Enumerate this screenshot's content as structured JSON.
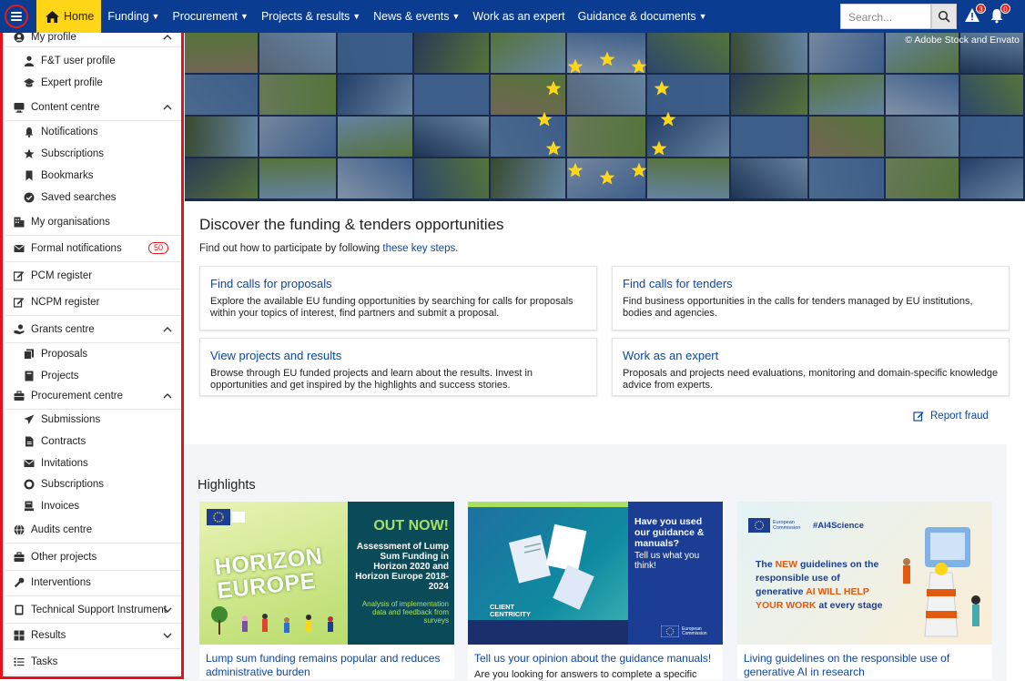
{
  "topbar": {
    "home": "Home",
    "nav": [
      {
        "label": "Funding",
        "dropdown": true
      },
      {
        "label": "Procurement",
        "dropdown": true
      },
      {
        "label": "Projects & results",
        "dropdown": true
      },
      {
        "label": "News & events",
        "dropdown": true
      },
      {
        "label": "Work as an expert",
        "dropdown": false
      },
      {
        "label": "Guidance & documents",
        "dropdown": true
      }
    ],
    "search_placeholder": "Search...",
    "alerts_count": "3",
    "notifications_count": "0"
  },
  "sidebar": {
    "items": [
      {
        "label": "My profile",
        "icon": "user-circle-icon",
        "level": 0,
        "chevron": "up"
      },
      {
        "label": "F&T user profile",
        "icon": "person-icon",
        "level": 1
      },
      {
        "label": "Expert profile",
        "icon": "graduation-cap-icon",
        "level": 1
      },
      {
        "label": "Content centre",
        "icon": "monitor-icon",
        "level": 0,
        "chevron": "up"
      },
      {
        "label": "Notifications",
        "icon": "bell-icon",
        "level": 1
      },
      {
        "label": "Subscriptions",
        "icon": "star-icon",
        "level": 1
      },
      {
        "label": "Bookmarks",
        "icon": "bookmark-icon",
        "level": 1
      },
      {
        "label": "Saved searches",
        "icon": "check-circle-icon",
        "level": 1
      },
      {
        "label": "My organisations",
        "icon": "building-icon",
        "level": 0
      },
      {
        "label": "Formal notifications",
        "icon": "envelope-icon",
        "level": 0,
        "count": "50"
      },
      {
        "label": "PCM register",
        "icon": "edit-icon",
        "level": 0
      },
      {
        "label": "NCPM register",
        "icon": "edit-icon",
        "level": 0
      },
      {
        "label": "Grants centre",
        "icon": "hand-coins-icon",
        "level": 0,
        "chevron": "up"
      },
      {
        "label": "Proposals",
        "icon": "documents-icon",
        "level": 1
      },
      {
        "label": "Projects",
        "icon": "book-icon",
        "level": 1
      },
      {
        "label": "Procurement centre",
        "icon": "briefcase-icon",
        "level": 0,
        "chevron": "up"
      },
      {
        "label": "Submissions",
        "icon": "paper-plane-icon",
        "level": 1
      },
      {
        "label": "Contracts",
        "icon": "file-icon",
        "level": 1
      },
      {
        "label": "Invitations",
        "icon": "envelope-icon",
        "level": 1
      },
      {
        "label": "Subscriptions",
        "icon": "ring-icon",
        "level": 1
      },
      {
        "label": "Invoices",
        "icon": "invoice-icon",
        "level": 1
      },
      {
        "label": "Audits centre",
        "icon": "globe-icon",
        "level": 0
      },
      {
        "label": "Other projects",
        "icon": "briefcase-icon",
        "level": 0
      },
      {
        "label": "Interventions",
        "icon": "wrench-icon",
        "level": 0
      },
      {
        "label": "Technical Support Instrument",
        "icon": "tablet-icon",
        "level": 0,
        "chevron": "down"
      },
      {
        "label": "Results",
        "icon": "grid-icon",
        "level": 0,
        "chevron": "down"
      },
      {
        "label": "Tasks",
        "icon": "list-icon",
        "level": 0
      }
    ]
  },
  "hero": {
    "credit": "© Adobe Stock and Envato"
  },
  "discover": {
    "title": "Discover the funding & tenders opportunities",
    "subtitle_prefix": "Find out how to participate by following ",
    "subtitle_link": "these key steps",
    "subtitle_suffix": "."
  },
  "cards": [
    {
      "title": "Find calls for proposals",
      "desc": "Explore the available EU funding opportunities by searching for calls for proposals within your topics of interest, find partners and submit a proposal."
    },
    {
      "title": "Find calls for tenders",
      "desc": "Find business opportunities in the calls for tenders managed by EU institutions, bodies and agencies."
    },
    {
      "title": "View projects and results",
      "desc": "Browse through EU funded projects and learn about the results. Invest in opportunities and get inspired by the highlights and success stories."
    },
    {
      "title": "Work as an expert",
      "desc": "Proposals and projects need evaluations, monitoring and domain-specific knowledge advice from experts."
    }
  ],
  "report_fraud": "Report fraud",
  "highlights": {
    "title": "Highlights",
    "items": [
      {
        "caption": "Lump sum funding remains popular and reduces administrative burden",
        "desc": "",
        "img": {
          "left_text": "HORIZON EUROPE",
          "headline": "OUT NOW!",
          "body": "Assessment of Lump Sum Funding in Horizon 2020 and Horizon Europe 2018-2024",
          "foot": "Analysis of implementation data and feedback from surveys"
        }
      },
      {
        "caption": "Tell us your opinion about the guidance manuals!",
        "desc": "Are you looking for answers to complete a specific",
        "img": {
          "headline": "Have you used our guidance & manuals?",
          "body": "Tell us what you think!",
          "tag": "CLIENT CENTRICITY",
          "ec": "European Commission"
        }
      },
      {
        "caption": "Living guidelines on the responsible use of generative AI in research",
        "desc": "",
        "img": {
          "hashtag": "#AI4Science",
          "ec": "European Commission",
          "l1a": "The ",
          "l1b": "NEW",
          "l1c": " guidelines on the",
          "l2": "responsible use of",
          "l3a": "generative ",
          "l3b": "AI WILL HELP",
          "l4a": "YOUR WORK",
          "l4b": " at every stage"
        }
      }
    ]
  },
  "colors": {
    "brand": "#0a3d91",
    "accent": "#ffd617",
    "link": "#0e47a1",
    "alert": "#e01b1b"
  }
}
